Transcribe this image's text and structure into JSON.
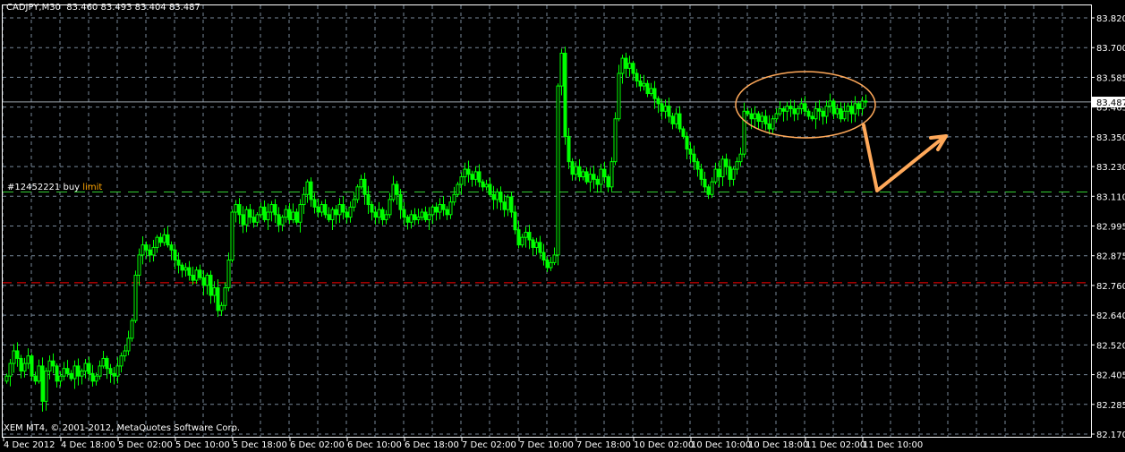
{
  "header": {
    "symbol": "CADJPY,M30",
    "open": "83.460",
    "high": "83.493",
    "low": "83.404",
    "close": "83.487"
  },
  "order_label": {
    "id": "#12452221",
    "type": "buy",
    "kind": "limit"
  },
  "copyright": "XEM MT4, © 2001-2012, MetaQuotes Software Corp.",
  "current_price_label": "83.487",
  "colors": {
    "bull": "#00ff00",
    "grid": "#778899",
    "order_line": "#32cd32",
    "stop_line": "#ff0000",
    "annotation": "#ffa95a",
    "axis": "#ffffff"
  },
  "chart_data": {
    "type": "candlestick",
    "title": "CADJPY,M30",
    "ylim": [
      82.17,
      83.82
    ],
    "yticks": [
      "83.820",
      "83.700",
      "83.585",
      "83.465",
      "83.350",
      "83.230",
      "83.110",
      "82.995",
      "82.875",
      "82.760",
      "82.640",
      "82.520",
      "82.405",
      "82.285",
      "82.170"
    ],
    "xticks": [
      "4 Dec 2012",
      "4 Dec 18:00",
      "5 Dec 02:00",
      "5 Dec 10:00",
      "5 Dec 18:00",
      "6 Dec 02:00",
      "6 Dec 10:00",
      "6 Dec 18:00",
      "7 Dec 02:00",
      "7 Dec 10:00",
      "7 Dec 18:00",
      "10 Dec 02:00",
      "10 Dec 10:00",
      "10 Dec 18:00",
      "11 Dec 02:00",
      "11 Dec 10:00"
    ],
    "bars_per_xtick": 16,
    "gap_after_bar": 153,
    "horizontal_lines": [
      {
        "name": "buy-limit",
        "price": 83.13
      },
      {
        "name": "stop-level",
        "price": 82.77
      },
      {
        "name": "current-price",
        "price": 83.487
      }
    ],
    "close": [
      82.4,
      82.45,
      82.5,
      82.47,
      82.42,
      82.45,
      82.48,
      82.4,
      82.38,
      82.44,
      82.3,
      82.42,
      82.46,
      82.44,
      82.38,
      82.4,
      82.43,
      82.41,
      82.39,
      82.44,
      82.4,
      82.42,
      82.45,
      82.41,
      82.38,
      82.4,
      82.44,
      82.47,
      82.43,
      82.41,
      82.4,
      82.44,
      82.48,
      82.5,
      82.55,
      82.62,
      82.8,
      82.88,
      82.92,
      82.9,
      82.88,
      82.91,
      82.95,
      82.93,
      82.96,
      82.92,
      82.9,
      82.86,
      82.84,
      82.82,
      82.83,
      82.8,
      82.78,
      82.82,
      82.79,
      82.76,
      82.8,
      82.72,
      82.75,
      82.66,
      82.68,
      82.75,
      82.86,
      83.05,
      83.08,
      83.04,
      83.0,
      83.06,
      83.03,
      83.01,
      83.04,
      83.07,
      83.02,
      83.05,
      83.08,
      83.04,
      83.0,
      83.03,
      83.06,
      83.02,
      83.05,
      83.01,
      83.08,
      83.12,
      83.17,
      83.1,
      83.07,
      83.05,
      83.08,
      83.04,
      83.02,
      83.06,
      83.04,
      83.08,
      83.05,
      83.03,
      83.07,
      83.1,
      83.15,
      83.18,
      83.12,
      83.08,
      83.05,
      83.03,
      83.06,
      83.02,
      83.04,
      83.1,
      83.16,
      83.12,
      83.06,
      83.03,
      83.01,
      83.04,
      83.02,
      83.03,
      83.05,
      83.02,
      83.04,
      83.07,
      83.05,
      83.08,
      83.06,
      83.04,
      83.09,
      83.12,
      83.16,
      83.19,
      83.22,
      83.2,
      83.18,
      83.21,
      83.17,
      83.15,
      83.16,
      83.12,
      83.1,
      83.13,
      83.09,
      83.06,
      83.11,
      83.05,
      82.98,
      82.92,
      82.95,
      82.97,
      82.94,
      82.91,
      82.93,
      82.89,
      82.86,
      82.83,
      82.85,
      82.88,
      83.55,
      83.68,
      83.35,
      83.25,
      83.2,
      83.23,
      83.19,
      83.21,
      83.17,
      83.2,
      83.18,
      83.16,
      83.22,
      83.19,
      83.15,
      83.25,
      83.42,
      83.6,
      83.66,
      83.62,
      83.64,
      83.6,
      83.57,
      83.55,
      83.56,
      83.52,
      83.54,
      83.5,
      83.48,
      83.45,
      83.47,
      83.43,
      83.4,
      83.44,
      83.38,
      83.35,
      83.3,
      83.28,
      83.25,
      83.22,
      83.18,
      83.15,
      83.12,
      83.17,
      83.22,
      83.19,
      83.26,
      83.23,
      83.18,
      83.22,
      83.25,
      83.28,
      83.45,
      83.44,
      83.42,
      83.44,
      83.41,
      83.43,
      83.4,
      83.38,
      83.42,
      83.44,
      83.46,
      83.45,
      83.47,
      83.46,
      83.44,
      83.46,
      83.48,
      83.45,
      83.43,
      83.42,
      83.46,
      83.45,
      83.43,
      83.47,
      83.49,
      83.44,
      83.46,
      83.42,
      83.45,
      83.47,
      83.44,
      83.48,
      83.46,
      83.49,
      83.487
    ]
  }
}
